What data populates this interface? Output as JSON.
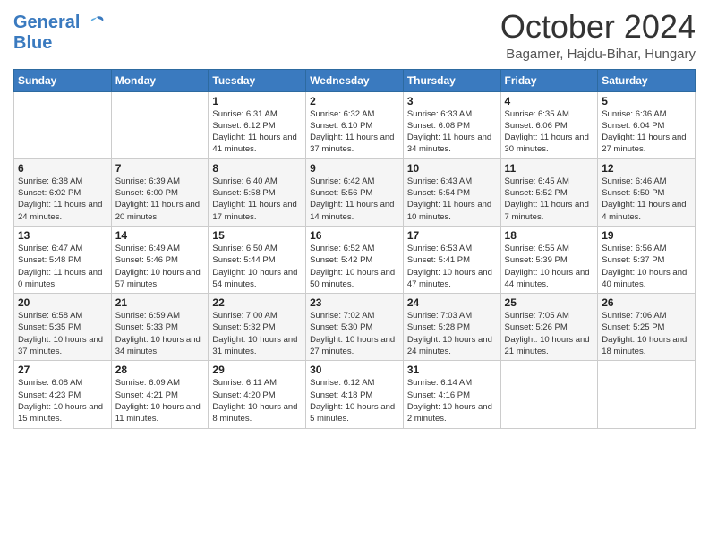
{
  "header": {
    "logo_line1": "General",
    "logo_line2": "Blue",
    "month": "October 2024",
    "location": "Bagamer, Hajdu-Bihar, Hungary"
  },
  "weekdays": [
    "Sunday",
    "Monday",
    "Tuesday",
    "Wednesday",
    "Thursday",
    "Friday",
    "Saturday"
  ],
  "weeks": [
    [
      {
        "day": "",
        "info": ""
      },
      {
        "day": "",
        "info": ""
      },
      {
        "day": "1",
        "info": "Sunrise: 6:31 AM\nSunset: 6:12 PM\nDaylight: 11 hours and 41 minutes."
      },
      {
        "day": "2",
        "info": "Sunrise: 6:32 AM\nSunset: 6:10 PM\nDaylight: 11 hours and 37 minutes."
      },
      {
        "day": "3",
        "info": "Sunrise: 6:33 AM\nSunset: 6:08 PM\nDaylight: 11 hours and 34 minutes."
      },
      {
        "day": "4",
        "info": "Sunrise: 6:35 AM\nSunset: 6:06 PM\nDaylight: 11 hours and 30 minutes."
      },
      {
        "day": "5",
        "info": "Sunrise: 6:36 AM\nSunset: 6:04 PM\nDaylight: 11 hours and 27 minutes."
      }
    ],
    [
      {
        "day": "6",
        "info": "Sunrise: 6:38 AM\nSunset: 6:02 PM\nDaylight: 11 hours and 24 minutes."
      },
      {
        "day": "7",
        "info": "Sunrise: 6:39 AM\nSunset: 6:00 PM\nDaylight: 11 hours and 20 minutes."
      },
      {
        "day": "8",
        "info": "Sunrise: 6:40 AM\nSunset: 5:58 PM\nDaylight: 11 hours and 17 minutes."
      },
      {
        "day": "9",
        "info": "Sunrise: 6:42 AM\nSunset: 5:56 PM\nDaylight: 11 hours and 14 minutes."
      },
      {
        "day": "10",
        "info": "Sunrise: 6:43 AM\nSunset: 5:54 PM\nDaylight: 11 hours and 10 minutes."
      },
      {
        "day": "11",
        "info": "Sunrise: 6:45 AM\nSunset: 5:52 PM\nDaylight: 11 hours and 7 minutes."
      },
      {
        "day": "12",
        "info": "Sunrise: 6:46 AM\nSunset: 5:50 PM\nDaylight: 11 hours and 4 minutes."
      }
    ],
    [
      {
        "day": "13",
        "info": "Sunrise: 6:47 AM\nSunset: 5:48 PM\nDaylight: 11 hours and 0 minutes."
      },
      {
        "day": "14",
        "info": "Sunrise: 6:49 AM\nSunset: 5:46 PM\nDaylight: 10 hours and 57 minutes."
      },
      {
        "day": "15",
        "info": "Sunrise: 6:50 AM\nSunset: 5:44 PM\nDaylight: 10 hours and 54 minutes."
      },
      {
        "day": "16",
        "info": "Sunrise: 6:52 AM\nSunset: 5:42 PM\nDaylight: 10 hours and 50 minutes."
      },
      {
        "day": "17",
        "info": "Sunrise: 6:53 AM\nSunset: 5:41 PM\nDaylight: 10 hours and 47 minutes."
      },
      {
        "day": "18",
        "info": "Sunrise: 6:55 AM\nSunset: 5:39 PM\nDaylight: 10 hours and 44 minutes."
      },
      {
        "day": "19",
        "info": "Sunrise: 6:56 AM\nSunset: 5:37 PM\nDaylight: 10 hours and 40 minutes."
      }
    ],
    [
      {
        "day": "20",
        "info": "Sunrise: 6:58 AM\nSunset: 5:35 PM\nDaylight: 10 hours and 37 minutes."
      },
      {
        "day": "21",
        "info": "Sunrise: 6:59 AM\nSunset: 5:33 PM\nDaylight: 10 hours and 34 minutes."
      },
      {
        "day": "22",
        "info": "Sunrise: 7:00 AM\nSunset: 5:32 PM\nDaylight: 10 hours and 31 minutes."
      },
      {
        "day": "23",
        "info": "Sunrise: 7:02 AM\nSunset: 5:30 PM\nDaylight: 10 hours and 27 minutes."
      },
      {
        "day": "24",
        "info": "Sunrise: 7:03 AM\nSunset: 5:28 PM\nDaylight: 10 hours and 24 minutes."
      },
      {
        "day": "25",
        "info": "Sunrise: 7:05 AM\nSunset: 5:26 PM\nDaylight: 10 hours and 21 minutes."
      },
      {
        "day": "26",
        "info": "Sunrise: 7:06 AM\nSunset: 5:25 PM\nDaylight: 10 hours and 18 minutes."
      }
    ],
    [
      {
        "day": "27",
        "info": "Sunrise: 6:08 AM\nSunset: 4:23 PM\nDaylight: 10 hours and 15 minutes."
      },
      {
        "day": "28",
        "info": "Sunrise: 6:09 AM\nSunset: 4:21 PM\nDaylight: 10 hours and 11 minutes."
      },
      {
        "day": "29",
        "info": "Sunrise: 6:11 AM\nSunset: 4:20 PM\nDaylight: 10 hours and 8 minutes."
      },
      {
        "day": "30",
        "info": "Sunrise: 6:12 AM\nSunset: 4:18 PM\nDaylight: 10 hours and 5 minutes."
      },
      {
        "day": "31",
        "info": "Sunrise: 6:14 AM\nSunset: 4:16 PM\nDaylight: 10 hours and 2 minutes."
      },
      {
        "day": "",
        "info": ""
      },
      {
        "day": "",
        "info": ""
      }
    ]
  ]
}
